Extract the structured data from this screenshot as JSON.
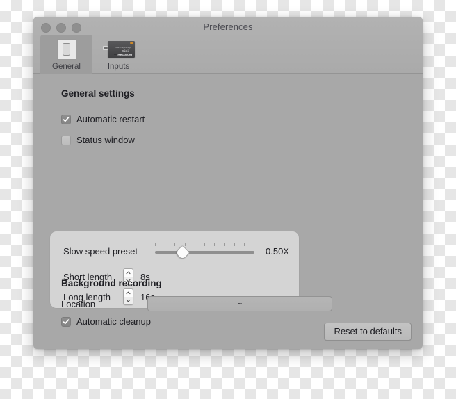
{
  "window": {
    "title": "Preferences",
    "traffic_lights": [
      "close-button",
      "minimize-button",
      "zoom-button"
    ]
  },
  "toolbar": {
    "tabs": [
      {
        "label": "General",
        "icon": "general-preferences-icon",
        "selected": true
      },
      {
        "label": "Inputs",
        "icon": "mini-recorder-device-icon",
        "selected": false
      }
    ],
    "device_icon": {
      "brand": "Blackmagicdesign",
      "model": "Mini Recorder",
      "accent_color": "#d08a28"
    }
  },
  "general_settings": {
    "title": "General settings",
    "checkboxes": [
      {
        "label": "Automatic restart",
        "checked": true
      },
      {
        "label": "Status window",
        "checked": false
      }
    ]
  },
  "preset_panel": {
    "slow_speed": {
      "label": "Slow speed preset",
      "value": "0.50X",
      "tick_count": 11,
      "thumb_position_percent": 27
    },
    "short_length": {
      "label": "Short length",
      "value": "8s"
    },
    "long_length": {
      "label": "Long length",
      "value": "16s"
    }
  },
  "background_recording": {
    "title": "Background recording",
    "location": {
      "label": "Location",
      "value": "~"
    },
    "automatic_cleanup": {
      "label": "Automatic cleanup",
      "checked": true
    }
  },
  "footer": {
    "reset_label": "Reset to defaults"
  },
  "colors": {
    "window_background": "#a8a8a8",
    "titlebar": "#aeaeae",
    "panel": "#d4d4d4",
    "text": "#1d1d22"
  }
}
